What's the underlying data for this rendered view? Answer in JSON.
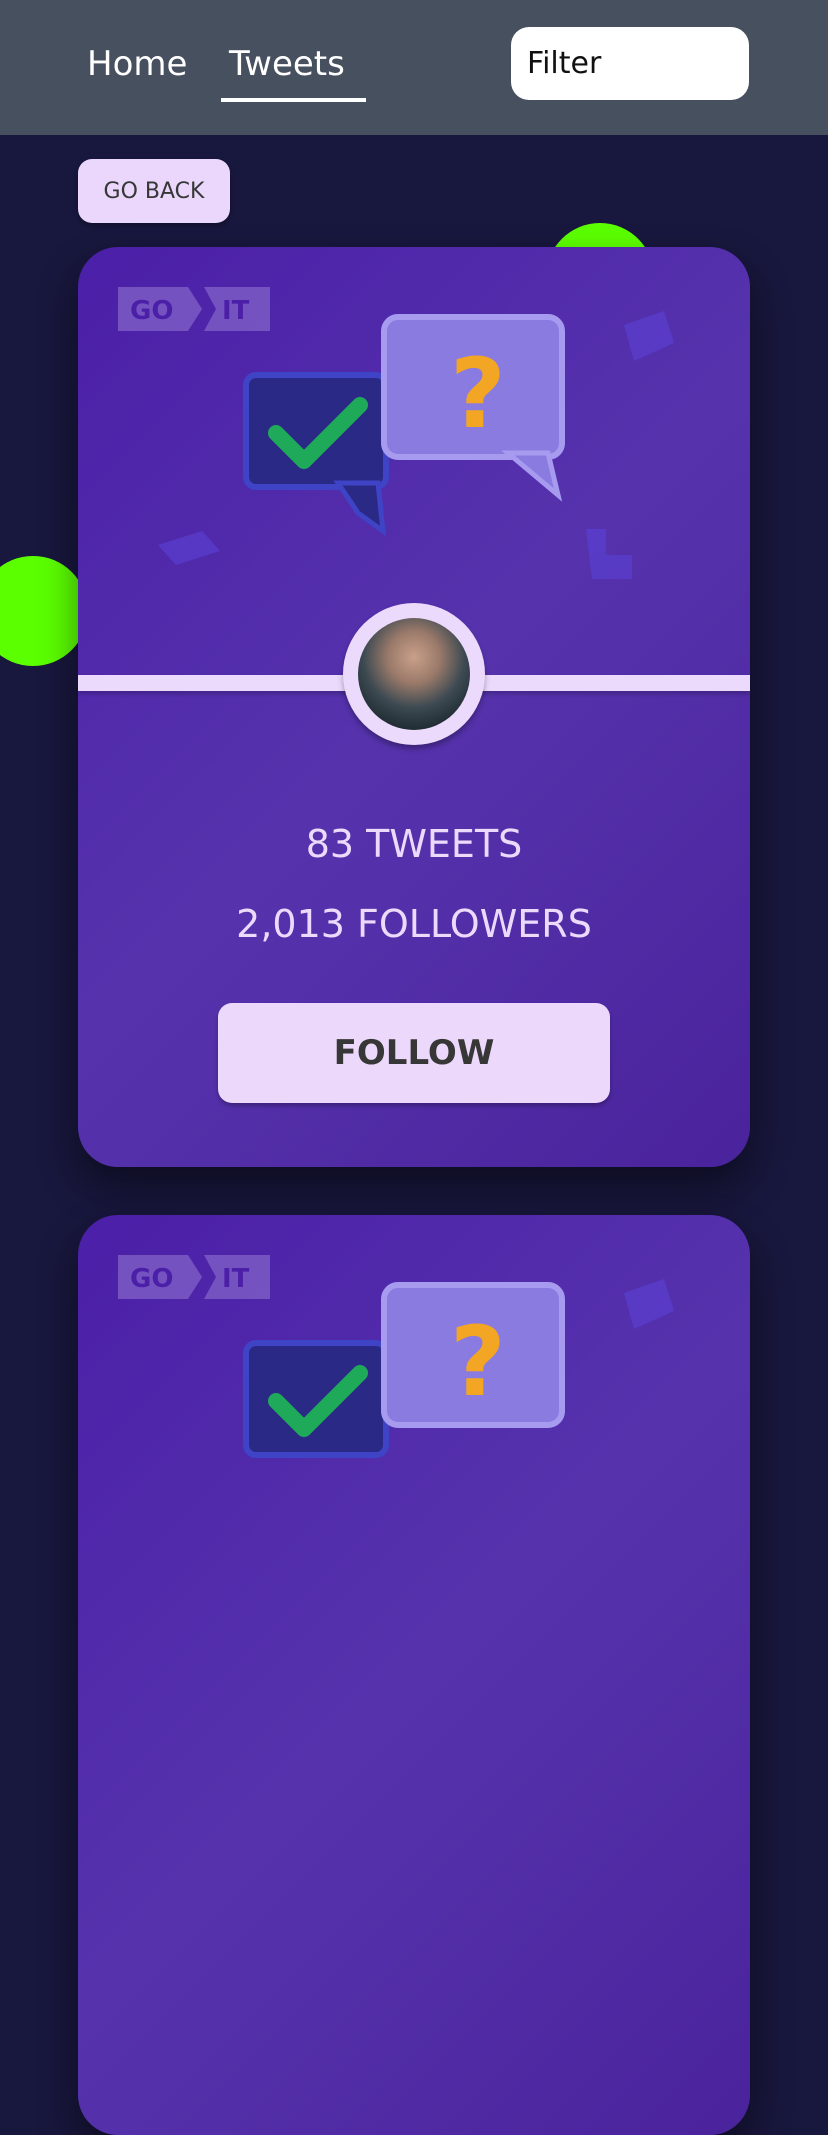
{
  "nav": {
    "home_label": "Home",
    "tweets_label": "Tweets"
  },
  "filter": {
    "placeholder": "Filter"
  },
  "back_label": "GO BACK",
  "cards": [
    {
      "tweets_text": "83 TWEETS",
      "followers_text": "2,013 FOLLOWERS",
      "follow_label": "FOLLOW"
    }
  ],
  "logo": {
    "left": "GO",
    "right": "IT"
  },
  "colors": {
    "accent_green": "#5cff00",
    "card": "#4b1fa8",
    "button": "#ebd8fb",
    "topbar": "#47505f"
  },
  "icons": [
    "checkmark-bubble-icon",
    "question-bubble-icon",
    "avatar"
  ]
}
